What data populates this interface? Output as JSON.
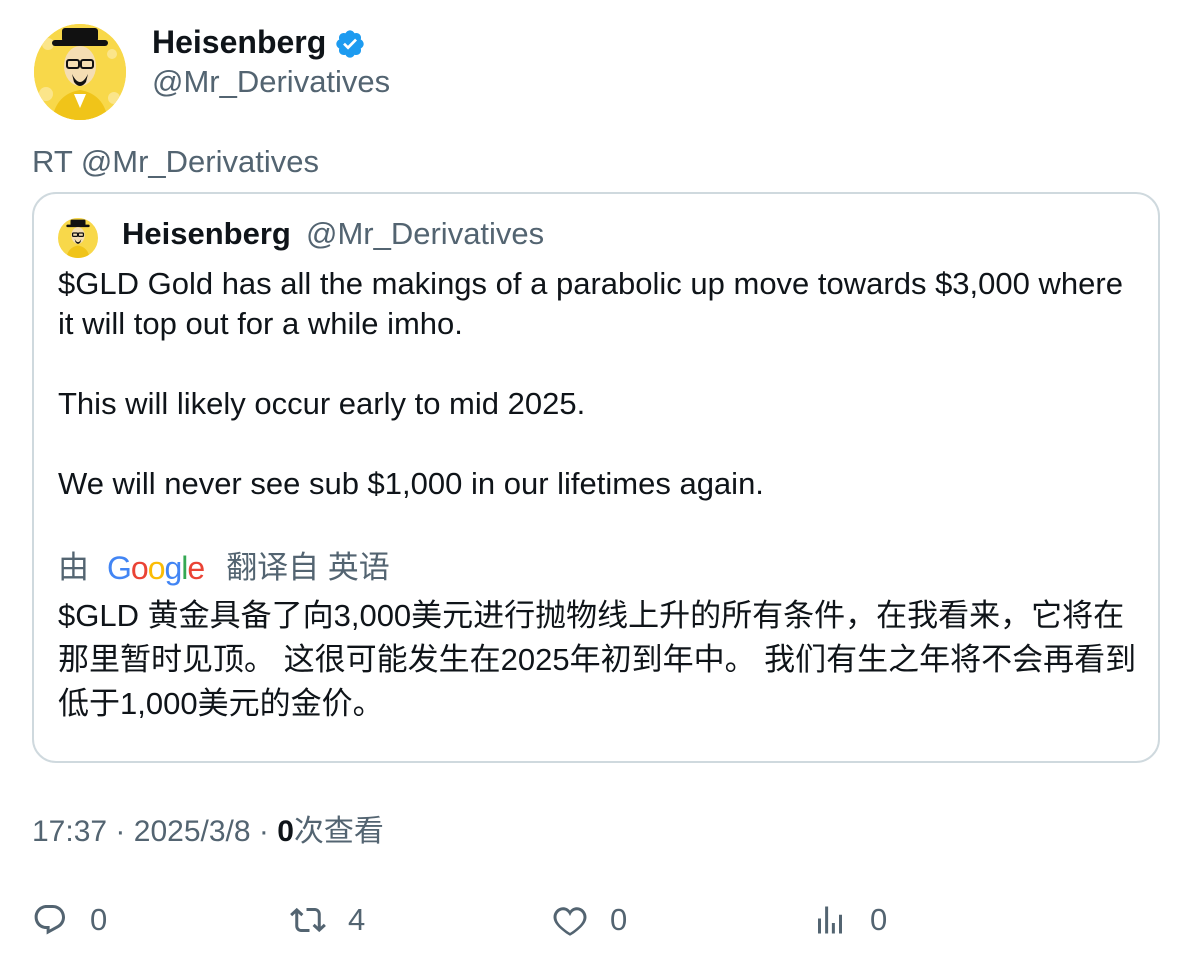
{
  "tweet": {
    "author_name": "Heisenberg",
    "author_handle": "@Mr_Derivatives",
    "retweet_text": "RT @Mr_Derivatives",
    "quoted": {
      "author_name": "Heisenberg",
      "author_handle": "@Mr_Derivatives",
      "paragraphs": [
        "$GLD Gold has all the makings of a parabolic up move towards $3,000 where it will top out for a while imho.",
        "This will likely occur early to mid 2025.",
        "We will never see sub $1,000 in our lifetimes again."
      ],
      "translate_prefix": "由",
      "translate_suffix": "翻译自 英语",
      "translated_text": "$GLD 黄金具备了向3,000美元进行抛物线上升的所有条件，在我看来，它将在那里暂时见顶。 这很可能发生在2025年初到年中。 我们有生之年将不会再看到低于1,000美元的金价。"
    },
    "time": "17:37",
    "date": "2025/3/8",
    "separator": "·",
    "views_count": "0",
    "views_label": "次查看",
    "actions": {
      "reply_count": "0",
      "retweet_count": "4",
      "like_count": "0",
      "views_count": "0"
    }
  },
  "icons": {
    "verified": "verified-badge-icon",
    "reply": "reply-icon",
    "retweet": "retweet-icon",
    "like": "heart-icon",
    "views": "bar-chart-icon"
  },
  "colors": {
    "verified": "#1d9bf0",
    "secondary_text": "#536471",
    "border": "#cfd9de",
    "avatar_bg": "#f8d84a"
  }
}
